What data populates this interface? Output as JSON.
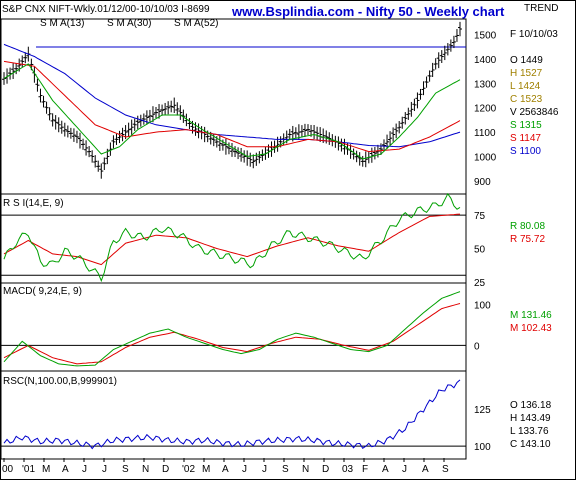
{
  "header": {
    "left": "S&P CNX NIFT-Wkly.01/12/00-10/10/03  I-8699",
    "title": "www.Bsplindia.com - Nifty 50 - Weekly chart",
    "right": "TREND"
  },
  "colors": {
    "price": "#000000",
    "sma13": "#00a000",
    "sma30": "#e00000",
    "sma52": "#0000cc",
    "rsi": "#00a000",
    "rsiAvg": "#e00000",
    "macd": "#00a000",
    "macdSig": "#e00000",
    "rsc": "#0000cc"
  },
  "chart_data": [
    {
      "type": "candlestick",
      "name": "price",
      "legend": [
        {
          "name": "S M A(13)",
          "color": "#00a000"
        },
        {
          "name": "S M A(30)",
          "color": "#e00000"
        },
        {
          "name": "S M A(52)",
          "color": "#0000cc"
        }
      ],
      "ylim": [
        850,
        1560
      ],
      "yticks": [
        900,
        1000,
        1100,
        1200,
        1300,
        1400,
        1500
      ],
      "hline": 1449,
      "readout": {
        "date": "F 10/10/03",
        "rows": [
          {
            "k": "O",
            "v": "1449",
            "color": "#000000"
          },
          {
            "k": "H",
            "v": "1527",
            "color": "#a08000"
          },
          {
            "k": "L",
            "v": "1424",
            "color": "#a08000"
          },
          {
            "k": "C",
            "v": "1523",
            "color": "#a08000"
          },
          {
            "k": "V",
            "v": "2563846",
            "color": "#000000"
          },
          {
            "k": "S",
            "v": "1315",
            "color": "#00a000"
          },
          {
            "k": "S",
            "v": "1147",
            "color": "#e00000"
          },
          {
            "k": "S",
            "v": "1100",
            "color": "#0000cc"
          }
        ]
      },
      "keypoints": [
        [
          0,
          1320
        ],
        [
          4,
          1360
        ],
        [
          8,
          1420
        ],
        [
          12,
          1250
        ],
        [
          16,
          1150
        ],
        [
          20,
          1110
        ],
        [
          24,
          1080
        ],
        [
          28,
          1020
        ],
        [
          32,
          940
        ],
        [
          36,
          1060
        ],
        [
          40,
          1100
        ],
        [
          44,
          1140
        ],
        [
          50,
          1180
        ],
        [
          56,
          1210
        ],
        [
          62,
          1120
        ],
        [
          66,
          1090
        ],
        [
          70,
          1060
        ],
        [
          76,
          1020
        ],
        [
          82,
          980
        ],
        [
          88,
          1030
        ],
        [
          94,
          1090
        ],
        [
          100,
          1110
        ],
        [
          106,
          1080
        ],
        [
          112,
          1040
        ],
        [
          118,
          980
        ],
        [
          124,
          1030
        ],
        [
          130,
          1120
        ],
        [
          136,
          1230
        ],
        [
          142,
          1380
        ],
        [
          148,
          1470
        ],
        [
          150,
          1523
        ]
      ],
      "sma13": [
        [
          0,
          1320
        ],
        [
          8,
          1380
        ],
        [
          16,
          1230
        ],
        [
          24,
          1120
        ],
        [
          32,
          1010
        ],
        [
          38,
          1040
        ],
        [
          44,
          1110
        ],
        [
          52,
          1170
        ],
        [
          58,
          1170
        ],
        [
          64,
          1120
        ],
        [
          72,
          1060
        ],
        [
          80,
          1000
        ],
        [
          86,
          1010
        ],
        [
          94,
          1070
        ],
        [
          102,
          1090
        ],
        [
          110,
          1060
        ],
        [
          118,
          990
        ],
        [
          124,
          1010
        ],
        [
          130,
          1080
        ],
        [
          136,
          1160
        ],
        [
          142,
          1260
        ],
        [
          150,
          1315
        ]
      ],
      "sma30": [
        [
          0,
          1390
        ],
        [
          10,
          1370
        ],
        [
          20,
          1250
        ],
        [
          30,
          1130
        ],
        [
          40,
          1080
        ],
        [
          50,
          1100
        ],
        [
          60,
          1110
        ],
        [
          70,
          1090
        ],
        [
          80,
          1040
        ],
        [
          90,
          1040
        ],
        [
          100,
          1070
        ],
        [
          110,
          1060
        ],
        [
          120,
          1020
        ],
        [
          130,
          1030
        ],
        [
          140,
          1080
        ],
        [
          150,
          1147
        ]
      ],
      "sma52": [
        [
          0,
          1460
        ],
        [
          10,
          1410
        ],
        [
          20,
          1340
        ],
        [
          30,
          1240
        ],
        [
          40,
          1170
        ],
        [
          50,
          1130
        ],
        [
          60,
          1110
        ],
        [
          70,
          1090
        ],
        [
          80,
          1080
        ],
        [
          90,
          1070
        ],
        [
          100,
          1070
        ],
        [
          110,
          1060
        ],
        [
          120,
          1045
        ],
        [
          130,
          1040
        ],
        [
          140,
          1060
        ],
        [
          150,
          1100
        ]
      ]
    },
    {
      "type": "line",
      "name": "R S I(14,E, 9)",
      "ylim": [
        25,
        90
      ],
      "yticks": [
        25,
        50,
        75
      ],
      "hlines": [
        75,
        30
      ],
      "readout": [
        {
          "k": "R",
          "v": "80.08",
          "color": "#00a000"
        },
        {
          "k": "R",
          "v": "75.72",
          "color": "#e00000"
        }
      ],
      "rsi": [
        [
          0,
          42
        ],
        [
          4,
          55
        ],
        [
          8,
          62
        ],
        [
          12,
          40
        ],
        [
          16,
          38
        ],
        [
          20,
          48
        ],
        [
          24,
          44
        ],
        [
          28,
          36
        ],
        [
          32,
          28
        ],
        [
          36,
          55
        ],
        [
          40,
          62
        ],
        [
          46,
          58
        ],
        [
          52,
          65
        ],
        [
          58,
          60
        ],
        [
          64,
          50
        ],
        [
          70,
          46
        ],
        [
          76,
          42
        ],
        [
          82,
          38
        ],
        [
          88,
          52
        ],
        [
          94,
          62
        ],
        [
          100,
          58
        ],
        [
          106,
          54
        ],
        [
          112,
          48
        ],
        [
          118,
          42
        ],
        [
          124,
          56
        ],
        [
          130,
          72
        ],
        [
          136,
          78
        ],
        [
          142,
          82
        ],
        [
          146,
          88
        ],
        [
          150,
          80.08
        ]
      ],
      "avg": [
        [
          0,
          46
        ],
        [
          8,
          56
        ],
        [
          16,
          46
        ],
        [
          24,
          44
        ],
        [
          32,
          38
        ],
        [
          40,
          54
        ],
        [
          50,
          60
        ],
        [
          60,
          58
        ],
        [
          70,
          50
        ],
        [
          80,
          44
        ],
        [
          90,
          52
        ],
        [
          100,
          58
        ],
        [
          110,
          52
        ],
        [
          120,
          48
        ],
        [
          130,
          62
        ],
        [
          140,
          74
        ],
        [
          150,
          75.72
        ]
      ]
    },
    {
      "type": "line",
      "name": "MACD( 9,24,E, 9)",
      "ylim": [
        -60,
        150
      ],
      "yticks": [
        100,
        0
      ],
      "readout": [
        {
          "k": "M",
          "v": "131.46",
          "color": "#00a000"
        },
        {
          "k": "M",
          "v": "102.43",
          "color": "#e00000"
        }
      ],
      "macd": [
        [
          0,
          -40
        ],
        [
          6,
          10
        ],
        [
          12,
          -25
        ],
        [
          18,
          -45
        ],
        [
          24,
          -50
        ],
        [
          30,
          -48
        ],
        [
          36,
          -10
        ],
        [
          42,
          10
        ],
        [
          48,
          30
        ],
        [
          54,
          40
        ],
        [
          60,
          20
        ],
        [
          66,
          5
        ],
        [
          72,
          -10
        ],
        [
          78,
          -20
        ],
        [
          84,
          -10
        ],
        [
          90,
          15
        ],
        [
          96,
          30
        ],
        [
          102,
          20
        ],
        [
          108,
          5
        ],
        [
          114,
          -10
        ],
        [
          120,
          -15
        ],
        [
          126,
          0
        ],
        [
          132,
          40
        ],
        [
          138,
          80
        ],
        [
          144,
          115
        ],
        [
          150,
          131.46
        ]
      ],
      "signal": [
        [
          0,
          -30
        ],
        [
          8,
          0
        ],
        [
          16,
          -30
        ],
        [
          24,
          -45
        ],
        [
          32,
          -40
        ],
        [
          40,
          -5
        ],
        [
          48,
          20
        ],
        [
          56,
          32
        ],
        [
          64,
          15
        ],
        [
          72,
          -5
        ],
        [
          80,
          -15
        ],
        [
          88,
          5
        ],
        [
          96,
          20
        ],
        [
          104,
          15
        ],
        [
          112,
          0
        ],
        [
          120,
          -12
        ],
        [
          128,
          10
        ],
        [
          136,
          50
        ],
        [
          144,
          90
        ],
        [
          150,
          102.43
        ]
      ]
    },
    {
      "type": "line",
      "name": "RSC(N,100.00,B,999901)",
      "ylim": [
        92,
        150
      ],
      "yticks": [
        125,
        100
      ],
      "hlines": [
        100
      ],
      "readout": [
        {
          "k": "O",
          "v": "136.18"
        },
        {
          "k": "H",
          "v": "143.49"
        },
        {
          "k": "L",
          "v": "133.76"
        },
        {
          "k": "C",
          "v": "143.10"
        }
      ],
      "rsc": [
        [
          0,
          102
        ],
        [
          6,
          106
        ],
        [
          12,
          103
        ],
        [
          18,
          104
        ],
        [
          24,
          102
        ],
        [
          30,
          100
        ],
        [
          36,
          104
        ],
        [
          42,
          105
        ],
        [
          48,
          106
        ],
        [
          54,
          104
        ],
        [
          60,
          103
        ],
        [
          66,
          104
        ],
        [
          72,
          102
        ],
        [
          78,
          101
        ],
        [
          84,
          103
        ],
        [
          90,
          104
        ],
        [
          96,
          105
        ],
        [
          102,
          104
        ],
        [
          108,
          102
        ],
        [
          114,
          101
        ],
        [
          120,
          100
        ],
        [
          126,
          104
        ],
        [
          132,
          112
        ],
        [
          138,
          125
        ],
        [
          144,
          138
        ],
        [
          150,
          143.1
        ]
      ]
    }
  ],
  "xaxis": [
    "00",
    "'01",
    "M",
    "A",
    "J",
    "J",
    "S",
    "N",
    "D",
    "'02",
    "M",
    "A",
    "J",
    "J",
    "S",
    "N",
    "D",
    "03",
    "F",
    "A",
    "J",
    "A",
    "S"
  ]
}
